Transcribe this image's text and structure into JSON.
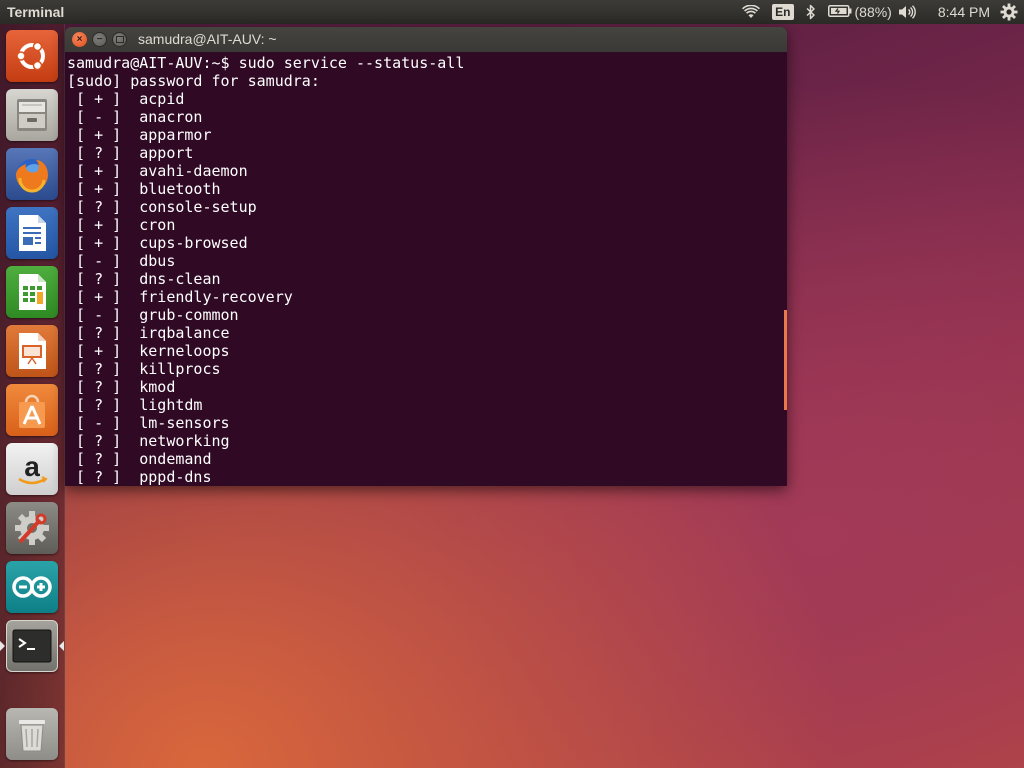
{
  "top_panel": {
    "app_title": "Terminal",
    "keyboard_layout": "En",
    "battery": "(88%)",
    "clock": "8:44 PM",
    "icons": [
      "wifi-icon",
      "keyboard-layout-indicator",
      "bluetooth-icon",
      "battery-icon",
      "volume-icon",
      "settings-gear-icon"
    ]
  },
  "launcher": {
    "items": [
      {
        "name": "dash-home",
        "icon": "ubuntu-logo-icon"
      },
      {
        "name": "files",
        "icon": "file-cabinet-icon"
      },
      {
        "name": "firefox",
        "icon": "firefox-icon"
      },
      {
        "name": "libreoffice-writer",
        "icon": "writer-document-icon"
      },
      {
        "name": "libreoffice-calc",
        "icon": "calc-spreadsheet-icon"
      },
      {
        "name": "libreoffice-impress",
        "icon": "impress-presentation-icon"
      },
      {
        "name": "ubuntu-software-center",
        "icon": "software-center-bag-icon"
      },
      {
        "name": "amazon",
        "icon": "amazon-icon"
      },
      {
        "name": "system-settings",
        "icon": "system-settings-icon"
      },
      {
        "name": "arduino",
        "icon": "arduino-icon"
      },
      {
        "name": "terminal",
        "icon": "terminal-icon"
      },
      {
        "name": "trash",
        "icon": "trash-icon"
      }
    ]
  },
  "terminal": {
    "window_title": "samudra@AIT-AUV: ~",
    "lines": [
      "samudra@AIT-AUV:~$ sudo service --status-all",
      "[sudo] password for samudra:",
      " [ + ]  acpid",
      " [ - ]  anacron",
      " [ + ]  apparmor",
      " [ ? ]  apport",
      " [ + ]  avahi-daemon",
      " [ + ]  bluetooth",
      " [ ? ]  console-setup",
      " [ + ]  cron",
      " [ + ]  cups-browsed",
      " [ - ]  dbus",
      " [ ? ]  dns-clean",
      " [ + ]  friendly-recovery",
      " [ - ]  grub-common",
      " [ ? ]  irqbalance",
      " [ + ]  kerneloops",
      " [ ? ]  killprocs",
      " [ ? ]  kmod",
      " [ ? ]  lightdm",
      " [ - ]  lm-sensors",
      " [ ? ]  networking",
      " [ ? ]  ondemand",
      " [ ? ]  pppd-dns"
    ]
  },
  "colors": {
    "terminal_bg": "#300a24",
    "panel_bg": "#2b2a26",
    "accent_orange": "#e9784d",
    "close_button": "#df4a16"
  }
}
